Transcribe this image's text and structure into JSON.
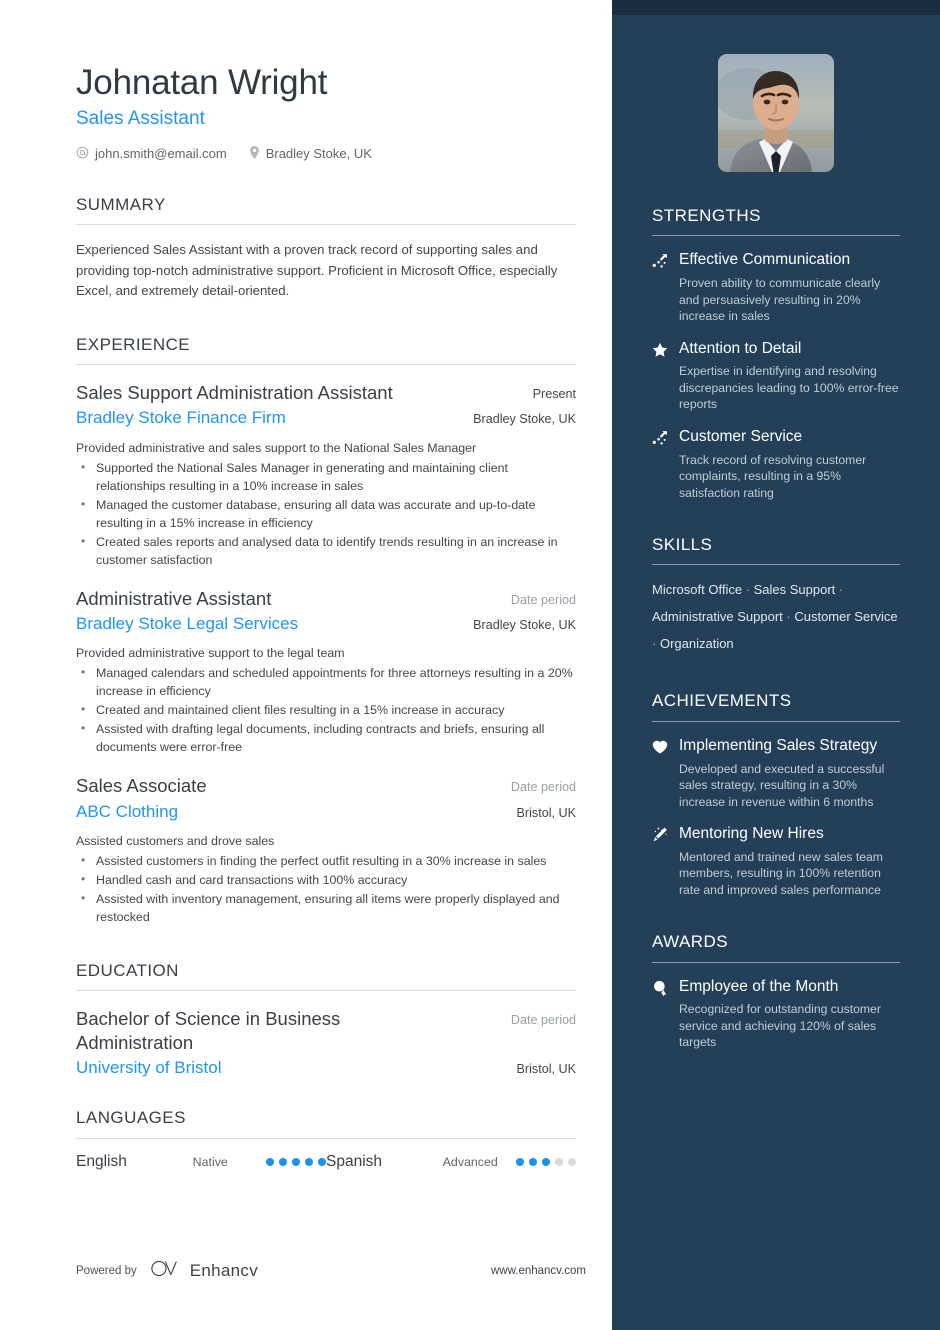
{
  "theme": {
    "accent": "#2196f3",
    "sidebar_bg": "#244059",
    "sidebar_topbar": "#1a2c3d",
    "heading": "#384049",
    "body_text": "#41474d",
    "muted": "#9aa1a8",
    "dot_on": "#1a91f0",
    "dot_off": "#d5dade"
  },
  "header": {
    "name": "Johnatan Wright",
    "job_title": "Sales Assistant",
    "email": "john.smith@email.com",
    "location": "Bradley Stoke, UK",
    "email_icon": "at-icon",
    "location_icon": "map-pin-icon"
  },
  "summary": {
    "title": "SUMMARY",
    "text": "Experienced Sales Assistant with a proven track record of supporting sales and providing top-notch administrative support. Proficient in Microsoft Office, especially Excel, and extremely detail-oriented."
  },
  "experience": {
    "title": "EXPERIENCE",
    "entries": [
      {
        "role": "Sales Support Administration Assistant",
        "date": "Present",
        "date_muted": false,
        "organization": "Bradley Stoke Finance Firm",
        "location": "Bradley Stoke, UK",
        "description": "Provided administrative and sales support to the National Sales Manager",
        "bullets": [
          "Supported the National Sales Manager in generating and maintaining client relationships resulting in a 10% increase in sales",
          "Managed the customer database, ensuring all data was accurate and up-to-date resulting in a 15% increase in efficiency",
          "Created sales reports and analysed data to identify trends resulting in an increase in customer satisfaction"
        ]
      },
      {
        "role": "Administrative Assistant",
        "date": "Date period",
        "date_muted": true,
        "organization": "Bradley Stoke Legal Services",
        "location": "Bradley Stoke, UK",
        "description": "Provided administrative support to the legal team",
        "bullets": [
          "Managed calendars and scheduled appointments for three attorneys resulting in a 20% increase in efficiency",
          "Created and maintained client files resulting in a 15% increase in accuracy",
          "Assisted with drafting legal documents, including contracts and briefs, ensuring all documents were error-free"
        ]
      },
      {
        "role": "Sales Associate",
        "date": "Date period",
        "date_muted": true,
        "organization": "ABC Clothing",
        "location": "Bristol, UK",
        "description": "Assisted customers and drove sales",
        "bullets": [
          "Assisted customers in finding the perfect outfit resulting in a 30% increase in sales",
          "Handled cash and card transactions with 100% accuracy",
          "Assisted with inventory management, ensuring all items were properly displayed and restocked"
        ]
      }
    ]
  },
  "education": {
    "title": "EDUCATION",
    "entries": [
      {
        "degree": "Bachelor of Science in Business Administration",
        "date": "Date period",
        "date_muted": true,
        "institution": "University of Bristol",
        "location": "Bristol, UK"
      }
    ]
  },
  "languages": {
    "title": "LANGUAGES",
    "items": [
      {
        "name": "English",
        "level": "Native",
        "filled": 5,
        "total": 5
      },
      {
        "name": "Spanish",
        "level": "Advanced",
        "filled": 3,
        "total": 5
      }
    ]
  },
  "footer": {
    "powered_by": "Powered by",
    "brand": "Enhancv",
    "brand_icon": "enhancv-logo-icon",
    "website": "www.enhancv.com"
  },
  "sidebar": {
    "photo_alt": "profile-photo",
    "strengths": {
      "title": "STRENGTHS",
      "items": [
        {
          "icon": "trend-arrow-icon",
          "title": "Effective Communication",
          "desc": "Proven ability to communicate clearly and persuasively resulting in 20% increase in sales"
        },
        {
          "icon": "star-icon",
          "title": "Attention to Detail",
          "desc": "Expertise in identifying and resolving discrepancies leading to 100% error-free reports"
        },
        {
          "icon": "trend-arrow-icon",
          "title": "Customer Service",
          "desc": "Track record of resolving customer complaints, resulting in a 95% satisfaction rating"
        }
      ]
    },
    "skills": {
      "title": "SKILLS",
      "separator": "·",
      "items": [
        "Microsoft Office",
        "Sales Support",
        "Administrative Support",
        "Customer Service",
        "Organization"
      ]
    },
    "achievements": {
      "title": "ACHIEVEMENTS",
      "items": [
        {
          "icon": "heart-icon",
          "title": "Implementing Sales Strategy",
          "desc": "Developed and executed a successful sales strategy, resulting in a 30% increase in revenue within 6 months"
        },
        {
          "icon": "magic-wand-icon",
          "title": "Mentoring New Hires",
          "desc": "Mentored and trained new sales team members, resulting in 100% retention rate and improved sales performance"
        }
      ]
    },
    "awards": {
      "title": "AWARDS",
      "items": [
        {
          "icon": "medal-icon",
          "title": "Employee of the Month",
          "desc": "Recognized for outstanding customer service and achieving 120% of sales targets"
        }
      ]
    }
  }
}
